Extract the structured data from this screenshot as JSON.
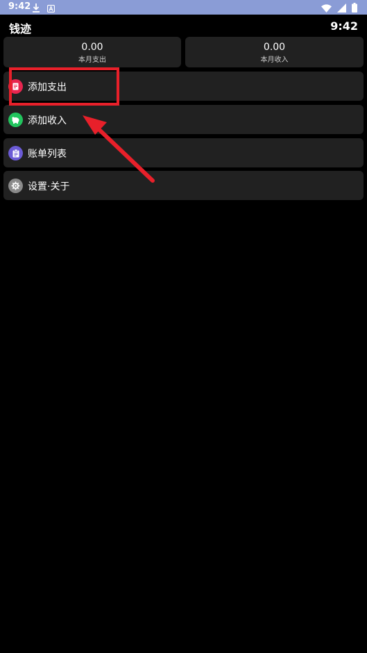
{
  "status_bar": {
    "time": "9:42",
    "left_icons": [
      "download-icon",
      "a-badge-icon"
    ],
    "right_icons": [
      "wifi-icon",
      "signal-icon",
      "battery-icon"
    ],
    "background": "#8a9cd6"
  },
  "header": {
    "title": "钱迹",
    "clock": "9:42"
  },
  "summary": {
    "expense": {
      "value": "0.00",
      "label": "本月支出"
    },
    "income": {
      "value": "0.00",
      "label": "本月收入"
    }
  },
  "menu": [
    {
      "label": "添加支出",
      "icon": "receipt-icon",
      "icon_color": "#e8264f"
    },
    {
      "label": "添加收入",
      "icon": "piggy-bank-icon",
      "icon_color": "#22c55e"
    },
    {
      "label": "账单列表",
      "icon": "clipboard-icon",
      "icon_color": "#6b5bd6"
    },
    {
      "label": "设置·关于",
      "icon": "gear-icon",
      "icon_color": "#8a8a8a"
    }
  ],
  "annotation": {
    "color": "#e8202a"
  }
}
